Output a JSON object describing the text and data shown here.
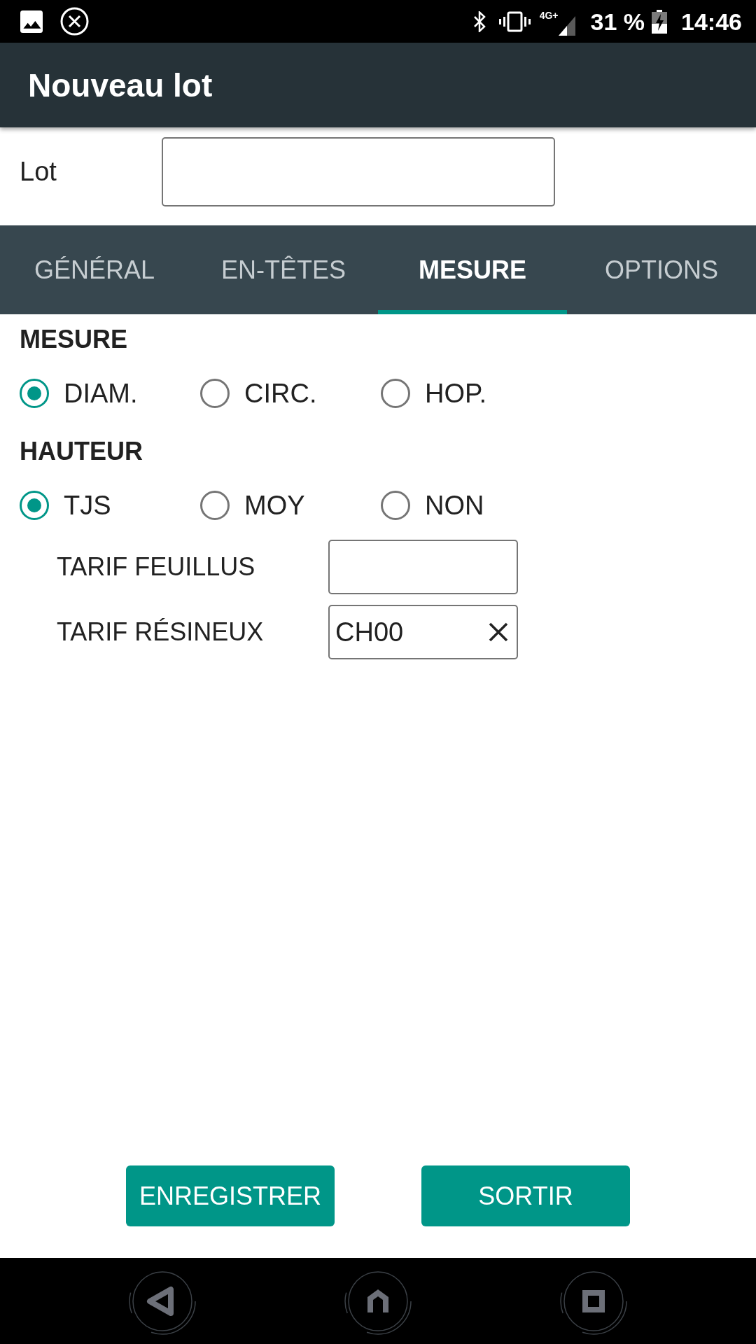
{
  "status_bar": {
    "network": "4G+",
    "battery": "31 %",
    "time": "14:46"
  },
  "app_bar": {
    "title": "Nouveau lot"
  },
  "lot": {
    "label": "Lot"
  },
  "tabs": [
    {
      "label": "GÉNÉRAL",
      "selected": false
    },
    {
      "label": "EN-TÊTES",
      "selected": false
    },
    {
      "label": "MESURE",
      "selected": true
    },
    {
      "label": "OPTIONS",
      "selected": false
    }
  ],
  "sections": [
    {
      "heading": "MESURE",
      "options": [
        {
          "label": "DIAM.",
          "selected": true
        },
        {
          "label": "CIRC.",
          "selected": false
        },
        {
          "label": "HOP.",
          "selected": false
        }
      ]
    },
    {
      "heading": "HAUTEUR",
      "options": [
        {
          "label": "TJS",
          "selected": true
        },
        {
          "label": "MOY",
          "selected": false
        },
        {
          "label": "NON",
          "selected": false
        }
      ],
      "fields": [
        {
          "label": "TARIF FEUILLUS"
        },
        {
          "label": "TARIF RÉSINEUX",
          "value": "CH00"
        }
      ]
    }
  ],
  "buttons": [
    {
      "label": "ENREGISTRER"
    },
    {
      "label": "SORTIR"
    }
  ]
}
